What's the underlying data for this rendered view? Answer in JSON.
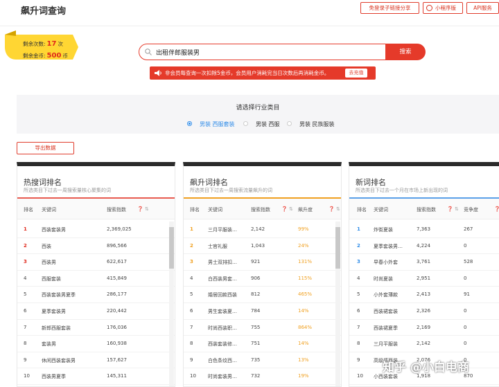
{
  "header": {
    "title": "飙升词查询",
    "buttons": [
      "免登录子链接分享",
      "小程序版",
      "API服务"
    ]
  },
  "quota": {
    "remaining_label": "剩余次数:",
    "remaining_value": "17",
    "remaining_unit": "次",
    "coins_label": "剩余金币:",
    "coins_value": "500",
    "coins_unit": "币"
  },
  "search": {
    "value": "出租伴郎服装男",
    "button": "搜索"
  },
  "notice": {
    "text": "非会员每查询一次扣除5金币，会员用户消耗完当日次数后再消耗金币。",
    "button": "去充值"
  },
  "category": {
    "title": "请选择行业类目",
    "options": [
      "男装 西服套装",
      "男装 西服",
      "男装 民族服装"
    ],
    "selected": "男装 西服套装"
  },
  "export_label": "导出数据",
  "colors": {
    "accent": "#e53a2a",
    "link": "#2f8ce8",
    "orange": "#f0a020"
  },
  "panels": [
    {
      "title": "热搜词排名",
      "subtitle": "所选类目下过去一周搜索量核心聚集的词",
      "headers": [
        "排名",
        "关键词",
        "搜索指数"
      ],
      "rows": [
        [
          "1",
          "西装套装男",
          "2,369,025"
        ],
        [
          "2",
          "西装",
          "896,566"
        ],
        [
          "3",
          "西装男",
          "622,617"
        ],
        [
          "4",
          "西服套装",
          "415,849"
        ],
        [
          "5",
          "西装套装男夏季",
          "286,177"
        ],
        [
          "6",
          "夏季套装男",
          "220,442"
        ],
        [
          "7",
          "新郎西服套装",
          "176,036"
        ],
        [
          "8",
          "套装男",
          "160,938"
        ],
        [
          "9",
          "休闲西装套装男",
          "157,627"
        ],
        [
          "10",
          "西装男夏季",
          "145,311"
        ]
      ]
    },
    {
      "title": "飙升词排名",
      "subtitle": "所选类目下过去一周搜索流量飙升的词",
      "headers": [
        "排名",
        "关键词",
        "搜索指数",
        "飙升度"
      ],
      "rows": [
        [
          "1",
          "三月平服装…",
          "2,142",
          "99%"
        ],
        [
          "2",
          "士官礼服",
          "1,043",
          "24%"
        ],
        [
          "3",
          "男士双排扣…",
          "921",
          "131%"
        ],
        [
          "4",
          "白西装男套…",
          "906",
          "115%"
        ],
        [
          "5",
          "婚居回款西装",
          "812",
          "465%"
        ],
        [
          "6",
          "男生套装夏…",
          "784",
          "14%"
        ],
        [
          "7",
          "时尚西装职…",
          "755",
          "864%"
        ],
        [
          "8",
          "西装套装修…",
          "751",
          "14%"
        ],
        [
          "9",
          "白色条纹西…",
          "735",
          "13%"
        ],
        [
          "10",
          "时尚套装男…",
          "732",
          "19%"
        ]
      ]
    },
    {
      "title": "新词排名",
      "subtitle": "所选类目下过去一个月在市场上新出现的词",
      "headers": [
        "排名",
        "关键词",
        "搜索指数",
        "竞争度"
      ],
      "rows": [
        [
          "1",
          "炸街夏装",
          "7,363",
          "267"
        ],
        [
          "2",
          "夏季套装男…",
          "4,224",
          "0"
        ],
        [
          "3",
          "早春小外套",
          "3,761",
          "528"
        ],
        [
          "4",
          "时尚夏装",
          "2,951",
          "0"
        ],
        [
          "5",
          "小外套薄款",
          "2,413",
          "91"
        ],
        [
          "6",
          "西装裙套装",
          "2,326",
          "0"
        ],
        [
          "7",
          "西装裙夏季",
          "2,169",
          "0"
        ],
        [
          "8",
          "三月平服装",
          "2,142",
          "0"
        ],
        [
          "9",
          "高级感西装…",
          "2,076",
          "0"
        ],
        [
          "10",
          "小西装套装",
          "1,918",
          "870"
        ]
      ]
    }
  ],
  "watermark": "知乎 @小白电商"
}
